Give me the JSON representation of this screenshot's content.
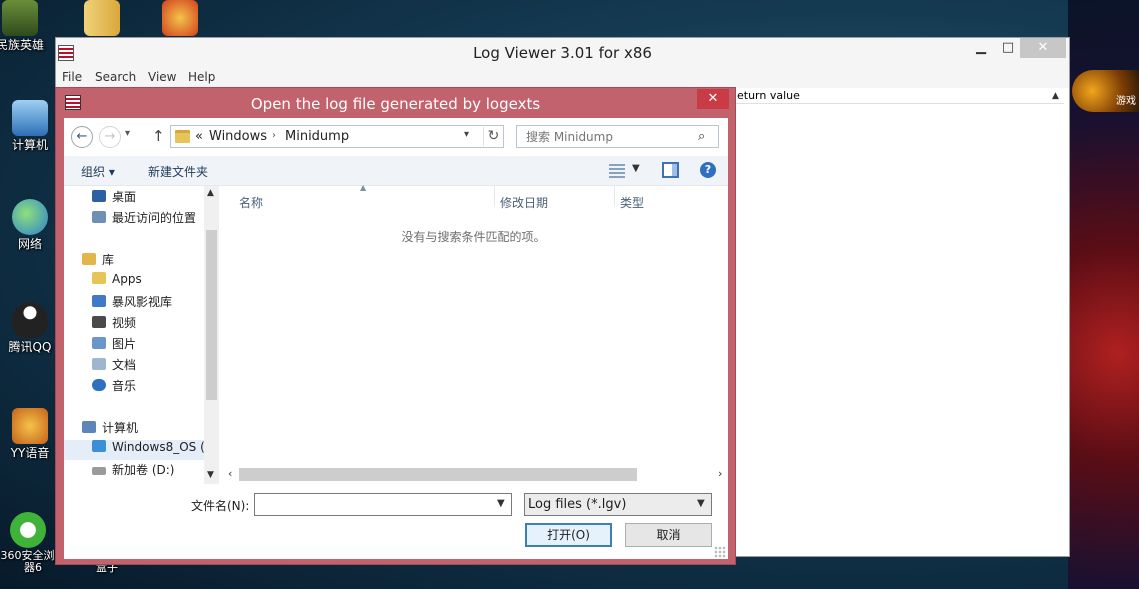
{
  "desktop": {
    "icons": [
      {
        "name": "minzu-yingxiong",
        "label": "民族英雄"
      },
      {
        "name": "folder-shortcut",
        "label": ""
      },
      {
        "name": "game-shortcut",
        "label": ""
      },
      {
        "name": "computer",
        "label": "计算机"
      },
      {
        "name": "network",
        "label": "网络"
      },
      {
        "name": "tencent-qq",
        "label": "腾讯QQ"
      },
      {
        "name": "yy-voice",
        "label": "YY语音"
      },
      {
        "name": "browser-360",
        "label": "360安全浏览器6"
      },
      {
        "name": "duowan-box",
        "label": "多玩英雄联盟盒子"
      }
    ],
    "side_badge_text": "游戏"
  },
  "log_viewer": {
    "title": "Log Viewer 3.01 for x86",
    "controls": {
      "minimize": "▁",
      "maximize": "□",
      "close": "✕"
    },
    "menu": [
      "File",
      "Search",
      "View",
      "Help"
    ],
    "column_header": "eturn value"
  },
  "dialog": {
    "title": "Open the log file generated by logexts",
    "close": "✕",
    "address": {
      "prefix": "«",
      "segments": [
        "Windows",
        "Minidump"
      ]
    },
    "search_placeholder": "搜索 Minidump",
    "toolbar": {
      "organize": "组织 ▾",
      "new_folder": "新建文件夹"
    },
    "tree": [
      {
        "label": "桌面",
        "icon": "desktop-icon",
        "color": "#2d5fa3"
      },
      {
        "label": "最近访问的位置",
        "icon": "recent-places-icon",
        "color": "#6f8fb5"
      },
      {
        "label": "库",
        "icon": "library-icon",
        "color": "#e2b64b"
      },
      {
        "label": "Apps",
        "icon": "folder-icon",
        "color": "#e7c457"
      },
      {
        "label": "暴风影视库",
        "icon": "media-library-icon",
        "color": "#3f79c8"
      },
      {
        "label": "视频",
        "icon": "video-icon",
        "color": "#4a4a4a"
      },
      {
        "label": "图片",
        "icon": "pictures-icon",
        "color": "#6b96c9"
      },
      {
        "label": "文档",
        "icon": "documents-icon",
        "color": "#9fb6cf"
      },
      {
        "label": "音乐",
        "icon": "music-icon",
        "color": "#2f6fc0"
      },
      {
        "label": "计算机",
        "icon": "computer-icon",
        "color": "#5c86b8"
      },
      {
        "label": "Windows8_OS (",
        "icon": "windows-drive-icon",
        "color": "#3b8fd6"
      },
      {
        "label": "新加卷 (D:)",
        "icon": "drive-icon",
        "color": "#9a9a9a"
      }
    ],
    "columns": [
      "名称",
      "修改日期",
      "类型"
    ],
    "empty_message": "没有与搜索条件匹配的项。",
    "filename_label": "文件名(N):",
    "filename_value": "",
    "filetype_value": "Log files (*.lgv)",
    "open_button": "打开(O)",
    "cancel_button": "取消"
  }
}
